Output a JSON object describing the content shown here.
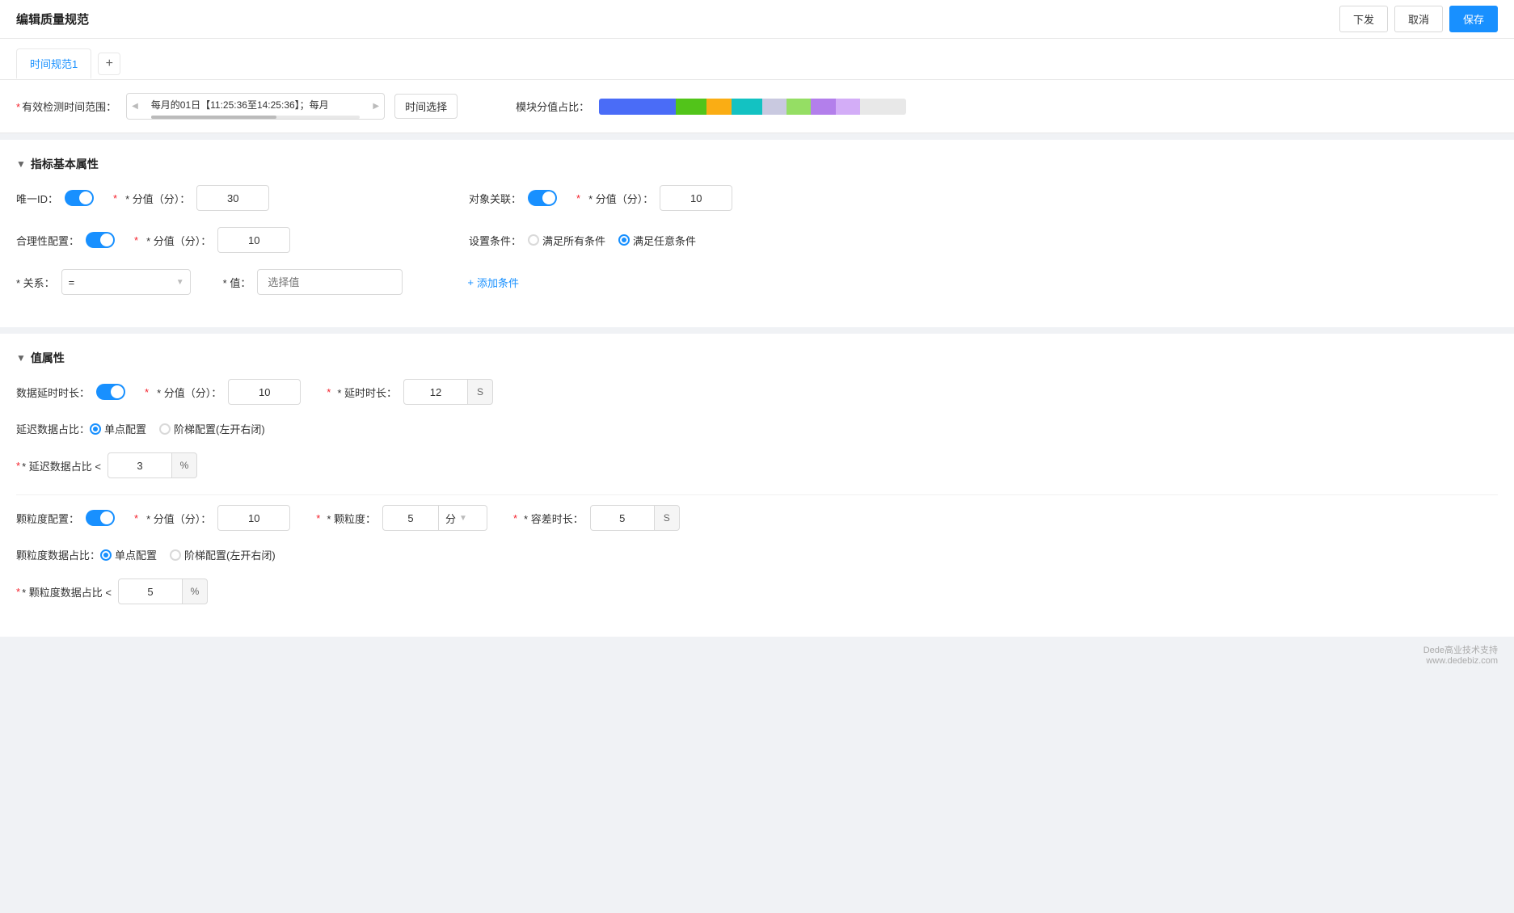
{
  "header": {
    "title": "编辑质量规范",
    "buttons": {
      "publish": "下发",
      "cancel": "取消",
      "save": "保存"
    }
  },
  "tabs": {
    "items": [
      {
        "label": "时间规范1",
        "active": true
      }
    ],
    "add_icon": "+"
  },
  "time_range": {
    "label": "有效检测时间范围：",
    "value": "每月的01日【11:25:36至14:25:36】；每月",
    "picker_btn": "时间选择",
    "score_label": "模块分值占比："
  },
  "score_segments": [
    {
      "color": "#4a6cf7",
      "width": 25
    },
    {
      "color": "#52c41a",
      "width": 10
    },
    {
      "color": "#faad14",
      "width": 8
    },
    {
      "color": "#13c2c2",
      "width": 10
    },
    {
      "color": "#b7b7d7",
      "width": 8
    },
    {
      "color": "#95de64",
      "width": 8
    },
    {
      "color": "#b37feb",
      "width": 8
    },
    {
      "color": "#d3adf7",
      "width": 8
    },
    {
      "color": "#e8e8e8",
      "width": 15
    }
  ],
  "basic_props": {
    "title": "指标基本属性",
    "unique_id": {
      "label": "唯一ID：",
      "toggle": true,
      "score_label": "* 分值（分）：",
      "score_value": "30"
    },
    "reasonable": {
      "label": "合理性配置：",
      "toggle": true,
      "score_label": "* 分值（分）：",
      "score_value": "10"
    },
    "relation": {
      "label": "* 关系：",
      "value": "=",
      "placeholder": "="
    },
    "value_field": {
      "label": "* 值：",
      "placeholder": "选择值"
    },
    "target_relation": {
      "label": "对象关联：",
      "toggle": true,
      "score_label": "* 分值（分）：",
      "score_value": "10"
    },
    "condition": {
      "label": "设置条件：",
      "radio_all": "满足所有条件",
      "radio_any": "满足任意条件",
      "selected": "any"
    },
    "add_condition": "添加条件"
  },
  "value_props": {
    "title": "值属性",
    "delay": {
      "label": "数据延时时长：",
      "toggle": true,
      "score_label": "* 分值（分）：",
      "score_value": "10",
      "delay_duration_label": "* 延时时长：",
      "delay_value": "12",
      "delay_unit": "S"
    },
    "delayed_ratio": {
      "label": "延迟数据占比：",
      "radio_single": "单点配置",
      "radio_step": "阶梯配置(左开右闭)",
      "selected": "single"
    },
    "delayed_ratio_input": {
      "label": "* 延迟数据占比 <",
      "value": "3",
      "unit": "%"
    },
    "granularity": {
      "label": "颗粒度配置：",
      "toggle": true,
      "score_label": "* 分值（分）：",
      "score_value": "10",
      "granularity_label": "* 颗粒度：",
      "granularity_value": "5",
      "granularity_unit": "分",
      "tolerance_label": "* 容差时长：",
      "tolerance_value": "5",
      "tolerance_unit": "S"
    },
    "granularity_ratio": {
      "label": "颗粒度数据占比：",
      "radio_single": "单点配置",
      "radio_step": "阶梯配置(左开右闭)",
      "selected": "single"
    },
    "granularity_ratio_input": {
      "label": "* 颗粒度数据占比 <",
      "value": "5",
      "unit": "%"
    }
  },
  "watermark": {
    "line1": "Dede高业技术支持",
    "line2": "www.dedebiz.com"
  }
}
